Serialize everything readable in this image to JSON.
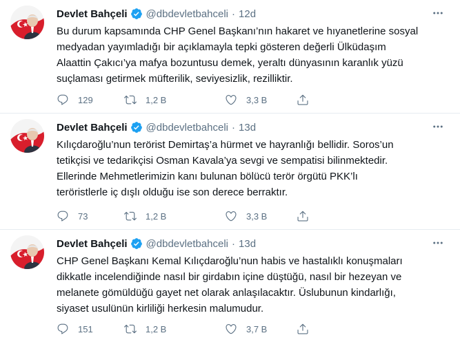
{
  "colors": {
    "handle": "#5b7083",
    "verified": "#1da1f2",
    "divider": "#e6ecf0",
    "text": "#0f1419"
  },
  "icons": {
    "reply": "reply-icon",
    "retweet": "retweet-icon",
    "like": "heart-icon",
    "share": "share-icon",
    "more": "more-icon",
    "verified": "verified-badge-icon"
  },
  "tweets": [
    {
      "name": "Devlet Bahçeli",
      "handle": "@dbdevletbahceli",
      "dot": "·",
      "time": "12d",
      "lines": [
        "Bu durum kapsamında CHP Genel Başkanı’nın hakaret ve hıyanetlerine sosyal",
        "medyadan yayımladığı bir açıklamayla tepki gösteren değerli Ülküdaşım",
        "Alaattin Çakıcı’ya mafya bozuntusu demek, yeraltı dünyasının karanlık yüzü",
        "suçlaması getirmek müfterilik, seviyesizlik, rezilliktir."
      ],
      "replies": "129",
      "retweets": "1,2 B",
      "likes": "3,3 B"
    },
    {
      "name": "Devlet Bahçeli",
      "handle": "@dbdevletbahceli",
      "dot": "·",
      "time": "13d",
      "lines": [
        "Kılıçdaroğlu’nun terörist Demirtaş’a hürmet ve hayranlığı bellidir. Soros’un",
        "tetikçisi ve tedarikçisi Osman Kavala’ya sevgi ve sempatisi bilinmektedir.",
        "Ellerinde Mehmetlerimizin kanı bulunan bölücü terör örgütü PKK’lı",
        "teröristlerle iç dışlı olduğu ise son derece berraktır."
      ],
      "replies": "73",
      "retweets": "1,2 B",
      "likes": "3,3 B"
    },
    {
      "name": "Devlet Bahçeli",
      "handle": "@dbdevletbahceli",
      "dot": "·",
      "time": "13d",
      "lines": [
        "CHP Genel Başkanı Kemal Kılıçdaroğlu’nun habis ve hastalıklı konuşmaları",
        "dikkatle incelendiğinde nasıl bir girdabın içine düştüğü, nasıl bir hezeyan ve",
        "melanete gömüldüğü gayet net olarak anlaşılacaktır. Üslubunun kindarlığı,",
        "siyaset usulünün kirliliği herkesin malumudur."
      ],
      "replies": "151",
      "retweets": "1,2 B",
      "likes": "3,7 B"
    }
  ]
}
